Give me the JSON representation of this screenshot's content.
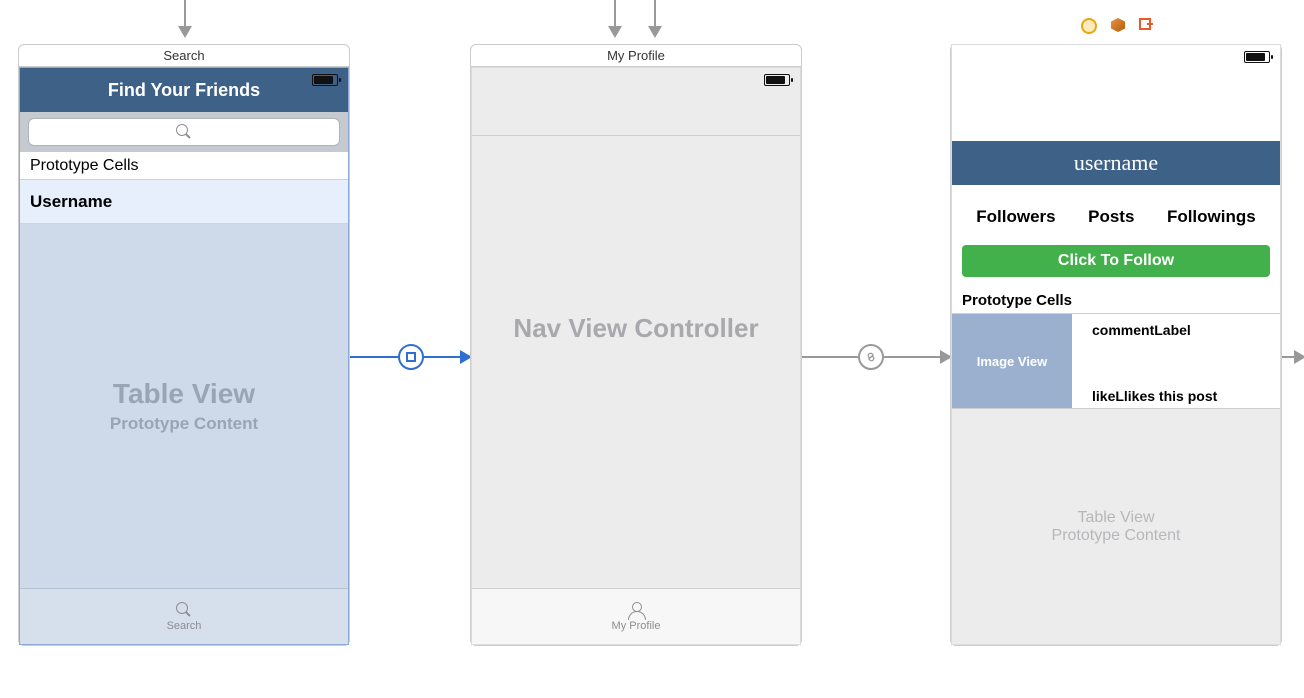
{
  "scene1": {
    "title": "Search",
    "nav_title": "Find Your Friends",
    "proto_header": "Prototype Cells",
    "proto_row": "Username",
    "table_big": "Table View",
    "table_sub": "Prototype Content",
    "tab_label": "Search"
  },
  "scene2": {
    "title": "My Profile",
    "center_label": "Nav View Controller",
    "tab_label": "My Profile"
  },
  "scene3": {
    "username": "username",
    "stats": {
      "followers": "Followers",
      "posts": "Posts",
      "followings": "Followings"
    },
    "follow_btn": "Click To Follow",
    "proto_header": "Prototype Cells",
    "image_view": "Image View",
    "comment": "commentLabel",
    "likes_label": "likeLlikes this post",
    "table_big": "Table View",
    "table_sub": "Prototype Content"
  }
}
